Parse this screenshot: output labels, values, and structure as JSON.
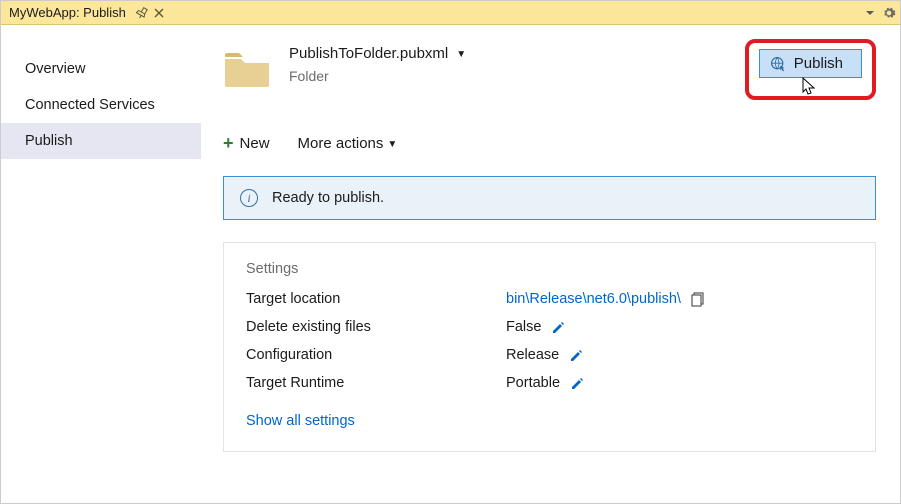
{
  "titlebar": {
    "title": "MyWebApp: Publish"
  },
  "sidebar": {
    "items": [
      {
        "label": "Overview"
      },
      {
        "label": "Connected Services"
      },
      {
        "label": "Publish"
      }
    ]
  },
  "profile": {
    "name": "PublishToFolder.pubxml",
    "subtitle": "Folder"
  },
  "publish_button_label": "Publish",
  "actions": {
    "new_label": "New",
    "more_label": "More actions"
  },
  "status": {
    "message": "Ready to publish."
  },
  "settings": {
    "heading": "Settings",
    "rows": [
      {
        "label": "Target location",
        "value": "bin\\Release\\net6.0\\publish\\",
        "link": true,
        "copy": true
      },
      {
        "label": "Delete existing files",
        "value": "False",
        "edit": true
      },
      {
        "label": "Configuration",
        "value": "Release",
        "edit": true
      },
      {
        "label": "Target Runtime",
        "value": "Portable",
        "edit": true
      }
    ],
    "show_all": "Show all settings"
  }
}
